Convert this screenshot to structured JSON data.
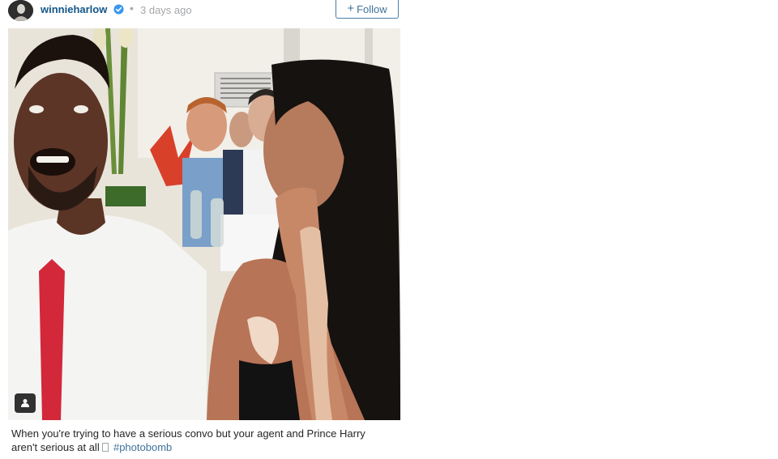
{
  "header": {
    "username": "winnieharlow",
    "separator": "•",
    "time_ago": "3 days ago",
    "follow_label": "Follow",
    "follow_plus": "+",
    "verified_color": "#3897f0"
  },
  "photo": {
    "tag_icon": "user-tag-icon"
  },
  "caption": {
    "text_part1": "When you're trying to have a serious convo but your agent and Prince Harry",
    "text_part2": "aren't serious at all",
    "hashtag": "#photobomb"
  },
  "colors": {
    "link": "#125688",
    "accent": "#3f729b",
    "muted": "#a5a7aa"
  }
}
